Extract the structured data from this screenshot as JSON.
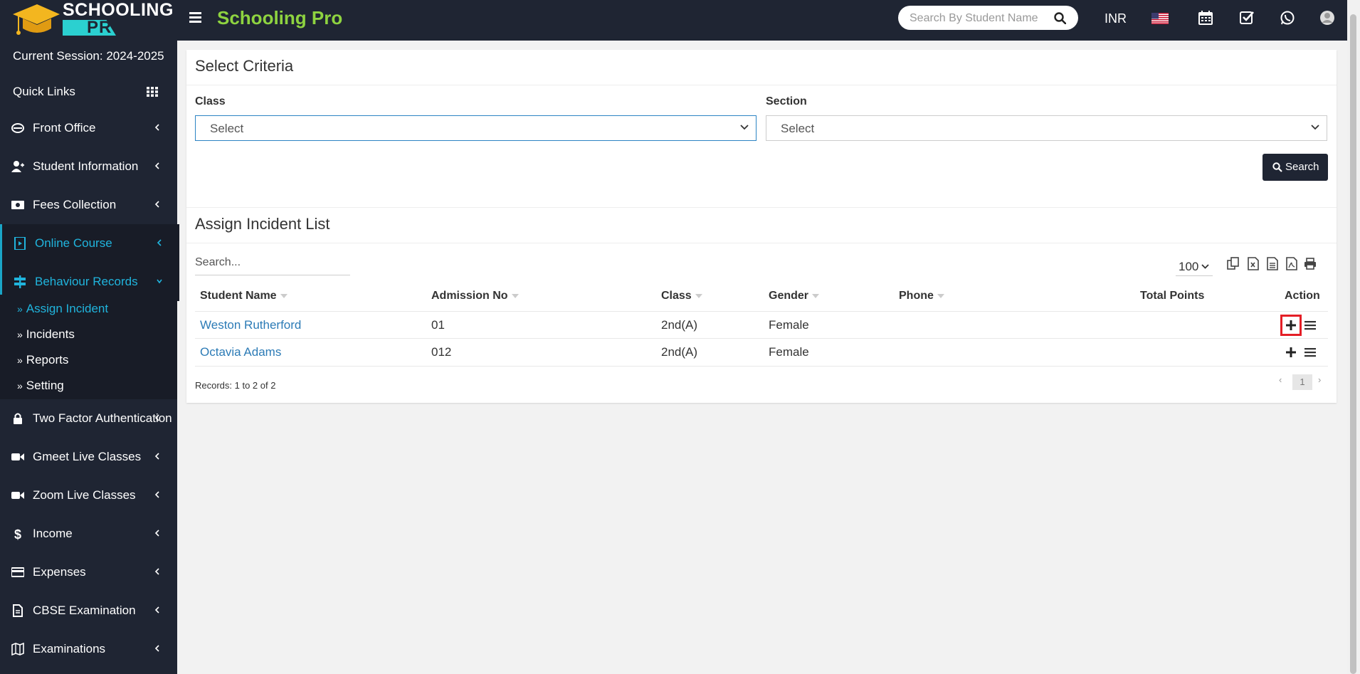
{
  "brand": {
    "logo_line1": "SCHOOLING",
    "logo_line2": "PRO",
    "app_title": "Schooling Pro"
  },
  "topbar": {
    "search_placeholder": "Search By Student Name",
    "currency": "INR",
    "icons": [
      "flag-us-icon",
      "calendar-icon",
      "checklist-icon",
      "whatsapp-icon",
      "user-avatar-icon"
    ]
  },
  "sidebar": {
    "session": "Current Session: 2024-2025",
    "quick_links": "Quick Links",
    "items": [
      {
        "label": "Front Office",
        "icon": "front-office-icon"
      },
      {
        "label": "Student Information",
        "icon": "user-plus-icon"
      },
      {
        "label": "Fees Collection",
        "icon": "money-icon"
      },
      {
        "label": "Online Course",
        "icon": "course-icon"
      },
      {
        "label": "Behaviour Records",
        "icon": "signpost-icon"
      },
      {
        "label": "Two Factor Authentication",
        "icon": "lock-icon"
      },
      {
        "label": "Gmeet Live Classes",
        "icon": "video-icon"
      },
      {
        "label": "Zoom Live Classes",
        "icon": "video-icon"
      },
      {
        "label": "Income",
        "icon": "dollar-icon"
      },
      {
        "label": "Expenses",
        "icon": "credit-card-icon"
      },
      {
        "label": "CBSE Examination",
        "icon": "document-icon"
      },
      {
        "label": "Examinations",
        "icon": "map-icon"
      }
    ],
    "submenu": [
      "Assign Incident",
      "Incidents",
      "Reports",
      "Setting"
    ]
  },
  "criteria": {
    "title": "Select Criteria",
    "class_label": "Class",
    "class_value": "Select",
    "section_label": "Section",
    "section_value": "Select",
    "search_button": "Search"
  },
  "list": {
    "title": "Assign Incident List",
    "search_placeholder": "Search...",
    "page_size": "100",
    "columns": [
      "Student Name",
      "Admission No",
      "Class",
      "Gender",
      "Phone",
      "Total Points",
      "Action"
    ],
    "rows": [
      {
        "name": "Weston Rutherford",
        "admission_no": "01",
        "class": "2nd(A)",
        "gender": "Female",
        "phone": "",
        "total_points": ""
      },
      {
        "name": "Octavia Adams",
        "admission_no": "012",
        "class": "2nd(A)",
        "gender": "Female",
        "phone": "",
        "total_points": ""
      }
    ],
    "records": "Records: 1 to 2 of 2",
    "page": "1",
    "prev": "‹",
    "next": "›"
  },
  "colors": {
    "topbar": "#1f2533",
    "accent_green": "#8ed340",
    "accent_cyan": "#20b4dd",
    "link": "#2c7bb6",
    "highlight": "#e41e26"
  }
}
